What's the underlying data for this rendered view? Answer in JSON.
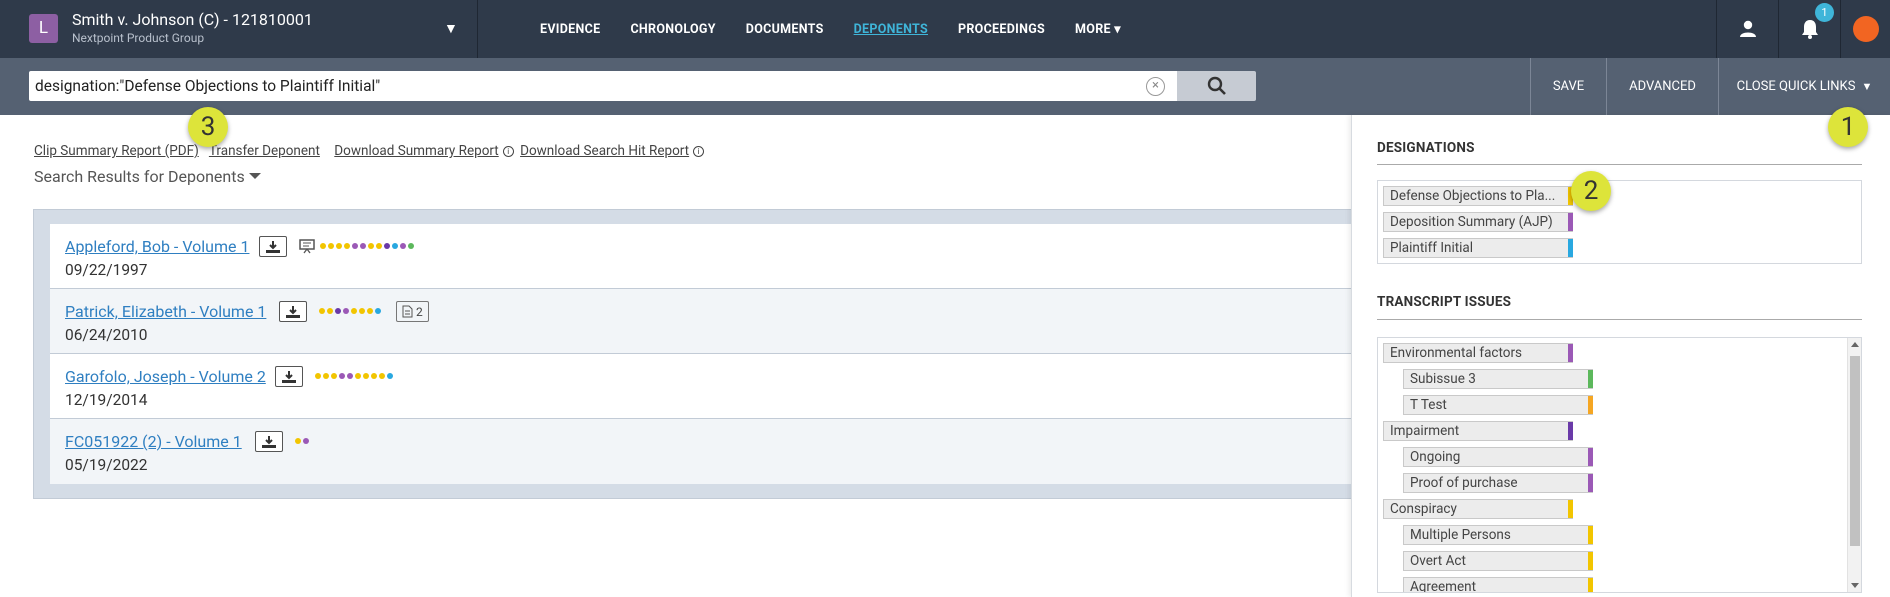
{
  "header": {
    "avatar_letter": "L",
    "case_title": "Smith v. Johnson (C) - 121810001",
    "case_subtitle": "Nextpoint Product Group",
    "nav": [
      "EVIDENCE",
      "CHRONOLOGY",
      "DOCUMENTS",
      "DEPONENTS",
      "PROCEEDINGS",
      "MORE ▾"
    ],
    "active_nav": "DEPONENTS",
    "notification_count": "1"
  },
  "search": {
    "query": "designation:\"Defense Objections to Plaintiff Initial\"",
    "save_label": "SAVE",
    "advanced_label": "ADVANCED",
    "quick_links_label": "CLOSE QUICK LINKS"
  },
  "links": {
    "clip_summary": "Clip Summary Report (PDF)",
    "transfer": "Transfer Deponent",
    "download_summary": "Download Summary Report",
    "download_hits": "Download Search Hit Report"
  },
  "results_heading": "Search Results for Deponents",
  "results": [
    {
      "name": "Appleford, Bob - Volume 1",
      "date": "09/22/1997",
      "dots": [
        "#f2c500",
        "#f2c500",
        "#f2c500",
        "#f2c500",
        "#9b59b6",
        "#9b59b6",
        "#f2c500",
        "#f2c500",
        "#6a3aa8",
        "#29a8e0",
        "#9b59b6",
        "#5cb85c"
      ]
    },
    {
      "name": "Patrick, Elizabeth - Volume 1",
      "date": "06/24/2010",
      "dots": [
        "#f2c500",
        "#f2c500",
        "#6a3aa8",
        "#9b59b6",
        "#f2c500",
        "#f2c500",
        "#f2c500",
        "#29a8e0"
      ],
      "doc_count": "2"
    },
    {
      "name": "Garofolo, Joseph - Volume 2",
      "date": "12/19/2014",
      "dots": [
        "#f2c500",
        "#f2c500",
        "#f2c500",
        "#9b59b6",
        "#9b59b6",
        "#f2c500",
        "#f2c500",
        "#f2c500",
        "#f2c500",
        "#29a8e0"
      ]
    },
    {
      "name": "FC051922 (2) - Volume 1",
      "date": "05/19/2022",
      "dots": [
        "#f2c500",
        "#9b59b6"
      ]
    }
  ],
  "panel": {
    "designations_title": "DESIGNATIONS",
    "designations": [
      {
        "label": "Defense Objections to Pla...",
        "color": "#f2c500"
      },
      {
        "label": "Deposition Summary (AJP)",
        "color": "#9b59b6"
      },
      {
        "label": "Plaintiff Initial",
        "color": "#29a8e0"
      }
    ],
    "issues_title": "TRANSCRIPT ISSUES",
    "issues": [
      {
        "label": "Environmental factors",
        "color": "#9b59b6",
        "indent": 0
      },
      {
        "label": "Subissue 3",
        "color": "#5cb85c",
        "indent": 1
      },
      {
        "label": "T Test",
        "color": "#f5a623",
        "indent": 1
      },
      {
        "label": "Impairment",
        "color": "#6a3aa8",
        "indent": 0
      },
      {
        "label": "Ongoing",
        "color": "#9b59b6",
        "indent": 1
      },
      {
        "label": "Proof of purchase",
        "color": "#9b59b6",
        "indent": 1
      },
      {
        "label": "Conspiracy",
        "color": "#f2c500",
        "indent": 0
      },
      {
        "label": "Multiple Persons",
        "color": "#f2c500",
        "indent": 1
      },
      {
        "label": "Overt Act",
        "color": "#f2c500",
        "indent": 1
      },
      {
        "label": "Agreement",
        "color": "#f2c500",
        "indent": 1
      }
    ]
  },
  "callouts": [
    "1",
    "2",
    "3"
  ]
}
